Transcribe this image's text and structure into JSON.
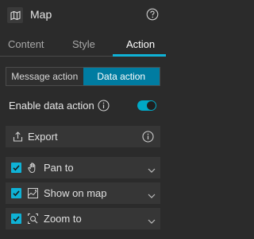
{
  "header": {
    "title": "Map",
    "map_icon": "map-icon",
    "help_icon": "help-icon"
  },
  "tabs": [
    {
      "label": "Content",
      "active": false
    },
    {
      "label": "Style",
      "active": false
    },
    {
      "label": "Action",
      "active": true
    }
  ],
  "segmented": {
    "options": [
      "Message action",
      "Data action"
    ],
    "selected": "Data action"
  },
  "enable_data_action": {
    "label": "Enable data action",
    "checked": true
  },
  "export": {
    "label": "Export",
    "icon": "export-icon",
    "info_icon": "info-icon"
  },
  "actions": [
    {
      "label": "Pan to",
      "checked": true,
      "icon": "hand-icon"
    },
    {
      "label": "Show on map",
      "checked": true,
      "icon": "show-on-map-icon"
    },
    {
      "label": "Zoom to",
      "checked": true,
      "icon": "zoom-to-icon"
    }
  ],
  "colors": {
    "accent": "#0fb2d6",
    "selected_bg": "#007ca1",
    "panel_bg": "#2b2b2b",
    "card_bg": "#363636"
  }
}
